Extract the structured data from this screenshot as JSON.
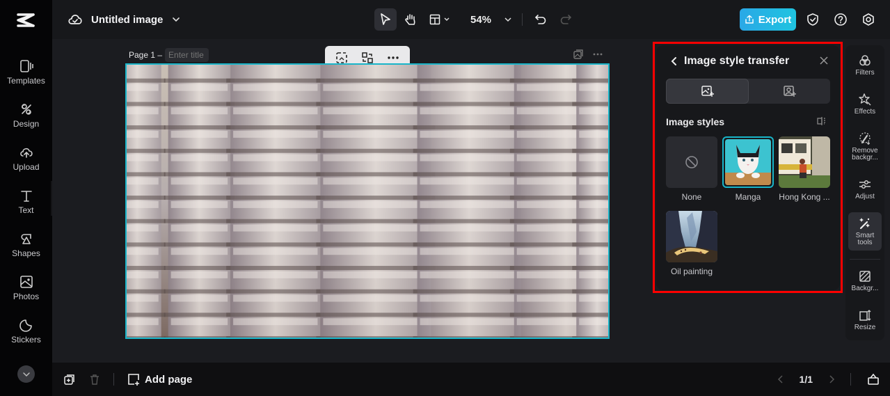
{
  "app": {
    "logo": "capcut-logo",
    "document_title": "Untitled image"
  },
  "leftnav": {
    "items": [
      {
        "label": "Templates",
        "icon": "templates-icon"
      },
      {
        "label": "Design",
        "icon": "design-icon"
      },
      {
        "label": "Upload",
        "icon": "upload-icon"
      },
      {
        "label": "Text",
        "icon": "text-icon"
      },
      {
        "label": "Shapes",
        "icon": "shapes-icon"
      },
      {
        "label": "Photos",
        "icon": "photos-icon"
      },
      {
        "label": "Stickers",
        "icon": "stickers-icon"
      }
    ]
  },
  "topbar": {
    "zoom_level": "54%",
    "export_label": "Export",
    "accent_color": "#1fb8e6"
  },
  "canvas": {
    "page_label": "Page 1 –",
    "title_placeholder": "Enter title",
    "selection_color": "#18b5c9"
  },
  "panel": {
    "title": "Image style transfer",
    "section_title": "Image styles",
    "styles": [
      {
        "name": "None",
        "selected": false
      },
      {
        "name": "Manga",
        "selected": true
      },
      {
        "name": "Hong Kong ...",
        "selected": false
      },
      {
        "name": "Oil painting",
        "selected": false
      }
    ]
  },
  "rail": {
    "items": [
      {
        "label": "Filters",
        "icon": "filters-icon"
      },
      {
        "label": "Effects",
        "icon": "effects-icon"
      },
      {
        "label": "Remove backgr...",
        "icon": "remove-background-icon"
      },
      {
        "label": "Adjust",
        "icon": "adjust-icon"
      },
      {
        "label": "Smart tools",
        "icon": "smart-tools-icon"
      },
      {
        "label": "Backgr...",
        "icon": "background-icon"
      },
      {
        "label": "Resize",
        "icon": "resize-icon"
      }
    ]
  },
  "bottombar": {
    "add_page_label": "Add page",
    "page_indicator": "1/1"
  }
}
